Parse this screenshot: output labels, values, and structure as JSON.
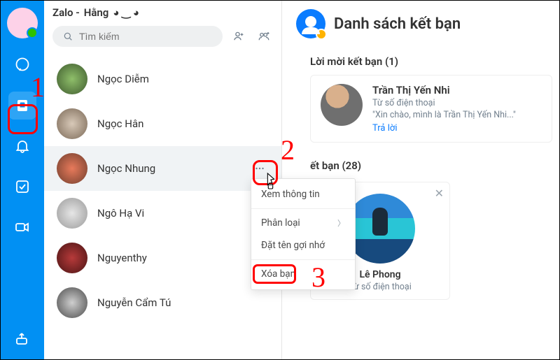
{
  "window_title_prefix": "Zalo - ",
  "window_title_name": "Hằng",
  "window_title_emoji": " ◕ ‿ ◕",
  "search": {
    "placeholder": "Tìm kiếm"
  },
  "contact_list": {
    "items": [
      {
        "name": "Ngọc Diễm"
      },
      {
        "name": "Ngọc Hân"
      },
      {
        "name": "Ngọc Nhung",
        "selected": true
      },
      {
        "name": "Ngô Hạ Vi"
      },
      {
        "name": "Nguyenthy"
      },
      {
        "name": "Nguyễn Cẩm Tú"
      }
    ]
  },
  "context_menu": {
    "items": {
      "view_info": "Xem thông tin",
      "categorize": "Phân loại",
      "set_nickname": "Đặt tên gợi nhớ",
      "remove_friend": "Xóa bạn"
    }
  },
  "right_panel": {
    "header": "Danh sách kết bạn",
    "requests_title_prefix": "Lời mời kết bạn (",
    "requests_count": "1",
    "requests_title_suffix": ")",
    "request": {
      "name": "Trần Thị Yến Nhi",
      "source": "Từ số điện thoại",
      "message": "\"Xin chào, mình là Trần Thị Yến Nhi...\"",
      "reply": "Trả lời"
    },
    "friends_title_prefix": "ết bạn (",
    "friends_count": "28",
    "friends_title_suffix": ")",
    "friend_card": {
      "name": "Lê Phong",
      "source": "Từ số điện thoại"
    }
  },
  "annotations": {
    "n1": "1",
    "n2": "2",
    "n3": "3"
  }
}
